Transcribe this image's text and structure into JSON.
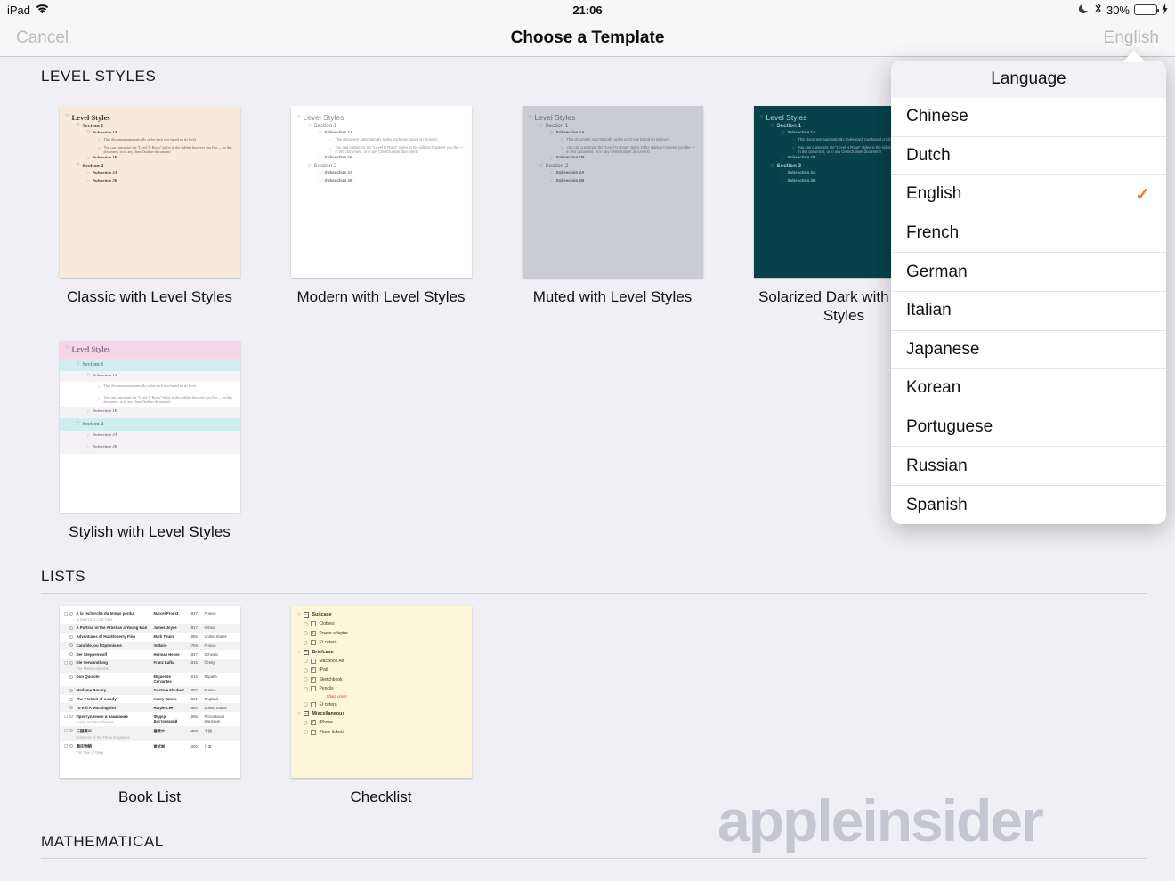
{
  "status_bar": {
    "device": "iPad",
    "wifi_icon": "wifi-icon",
    "time": "21:06",
    "moon_icon": "moon-icon",
    "bluetooth_icon": "bluetooth-icon",
    "battery_percent": "30%",
    "battery_icon": "battery-icon",
    "charging_icon": "charging-bolt-icon"
  },
  "nav": {
    "cancel_label": "Cancel",
    "title": "Choose a Template",
    "language_label": "English"
  },
  "sections": [
    {
      "id": "level-styles",
      "title": "LEVEL STYLES"
    },
    {
      "id": "lists",
      "title": "LISTS"
    },
    {
      "id": "mathematical",
      "title": "MATHEMATICAL"
    }
  ],
  "templates": {
    "classic": {
      "caption": "Classic with Level Styles"
    },
    "modern": {
      "caption": "Modern with Level Styles"
    },
    "muted": {
      "caption": "Muted with Level Styles"
    },
    "solarized": {
      "caption": "Solarized Dark with Level Styles"
    },
    "stylish": {
      "caption": "Stylish with Level Styles"
    },
    "book_list": {
      "caption": "Book List"
    },
    "checklist": {
      "caption": "Checklist"
    }
  },
  "outline_sample": {
    "title": "Level Styles",
    "section1": "Section 1",
    "sub1a": "Subsection 1A",
    "body1": "This document automatically styles each row based on its level.",
    "body2": "You can customize the \"Level N Rows\" styles in the sidebar however you like — in this document, or in any OmniOutliner document!",
    "sub1b": "Subsection 1B",
    "section2": "Section 2",
    "sub2a": "Subsection 2A",
    "sub2b": "Subsection 2B"
  },
  "book_list_rows": [
    {
      "title": "À la recherche du temps perdu",
      "subtitle": "In Search of Lost Time",
      "author": "Marcel Proust",
      "year": "1927",
      "country": "France",
      "shaded": false
    },
    {
      "title": "A Portrait of the Artist as a Young Man",
      "subtitle": "",
      "author": "James Joyce",
      "year": "1917",
      "country": "Ireland",
      "shaded": true
    },
    {
      "title": "Adventures of Huckleberry Finn",
      "subtitle": "",
      "author": "Mark Twain",
      "year": "1885",
      "country": "United States",
      "shaded": false
    },
    {
      "title": "Candide, ou l'Optimisme",
      "subtitle": "",
      "author": "Voltaire",
      "year": "1759",
      "country": "France",
      "shaded": true
    },
    {
      "title": "Der Steppenwolf",
      "subtitle": "",
      "author": "Herman Hesse",
      "year": "1927",
      "country": "Schweiz",
      "shaded": false
    },
    {
      "title": "Die Verwandlung",
      "subtitle": "The Metamorphosis",
      "author": "Franz Kafka",
      "year": "1915",
      "country": "Česky",
      "shaded": true
    },
    {
      "title": "Don Quixote",
      "subtitle": "",
      "author": "Miguel de Cervantes",
      "year": "1615",
      "country": "España",
      "shaded": false
    },
    {
      "title": "Madame Bovary",
      "subtitle": "",
      "author": "Gustave Flaubert",
      "year": "1857",
      "country": "France",
      "shaded": true
    },
    {
      "title": "The Portrait of a Lady",
      "subtitle": "",
      "author": "Henry James",
      "year": "1881",
      "country": "England",
      "shaded": false
    },
    {
      "title": "To Kill A Mockingbird",
      "subtitle": "",
      "author": "Harper Lee",
      "year": "1960",
      "country": "United States",
      "shaded": true
    },
    {
      "title": "Преступление и наказание",
      "subtitle": "Crime and Punishment",
      "author": "Фёдор Достоевский",
      "year": "1866",
      "country": "Российская Империя",
      "shaded": false
    },
    {
      "title": "三国演义",
      "subtitle": "Romance of the Three Kingdoms",
      "author": "羅貫中",
      "year": "1323",
      "country": "中國",
      "shaded": true
    },
    {
      "title": "源氏物語",
      "subtitle": "The Tale of Genji",
      "author": "紫式部",
      "year": "1000",
      "country": "日本",
      "shaded": false
    }
  ],
  "checklist_rows": [
    {
      "label": "Suitcase",
      "type": "group",
      "checked": false
    },
    {
      "label": "Clothes",
      "type": "item",
      "checked": false
    },
    {
      "label": "Power adapter",
      "type": "item",
      "checked": true
    },
    {
      "label": "Et cetera",
      "type": "item",
      "checked": false
    },
    {
      "label": "Briefcase",
      "type": "group",
      "checked": false
    },
    {
      "label": "MacBook Air",
      "type": "item",
      "checked": false
    },
    {
      "label": "iPad",
      "type": "item",
      "checked": true
    },
    {
      "label": "Sketchbook",
      "type": "item",
      "checked": true
    },
    {
      "label": "Pencils",
      "type": "item",
      "checked": false
    },
    {
      "label": "Et cetera",
      "type": "item",
      "checked": false
    },
    {
      "label": "Miscellaneous",
      "type": "group",
      "checked": false
    },
    {
      "label": "iPhone",
      "type": "item",
      "checked": true
    },
    {
      "label": "Plane tickets",
      "type": "item",
      "checked": false
    }
  ],
  "checklist_note": "Sharp ones!",
  "language_popover": {
    "title": "Language",
    "selected": "English",
    "check_color": "#f08020",
    "items": [
      {
        "label": "Chinese",
        "selected": false
      },
      {
        "label": "Dutch",
        "selected": false
      },
      {
        "label": "English",
        "selected": true
      },
      {
        "label": "French",
        "selected": false
      },
      {
        "label": "German",
        "selected": false
      },
      {
        "label": "Italian",
        "selected": false
      },
      {
        "label": "Japanese",
        "selected": false
      },
      {
        "label": "Korean",
        "selected": false
      },
      {
        "label": "Portuguese",
        "selected": false
      },
      {
        "label": "Russian",
        "selected": false
      },
      {
        "label": "Spanish",
        "selected": false
      }
    ]
  },
  "watermark": {
    "text": "appleinsider"
  },
  "glyphs": {
    "check": "✓",
    "minus": "–",
    "triangle": "▽",
    "chevron": "▿"
  }
}
